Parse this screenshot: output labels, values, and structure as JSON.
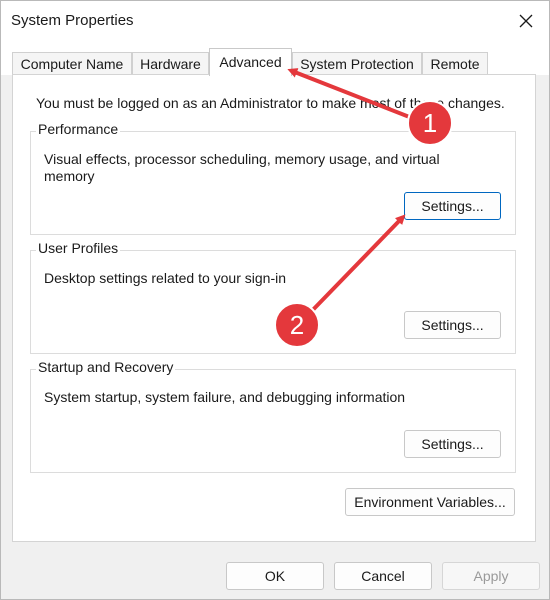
{
  "window": {
    "title": "System Properties"
  },
  "tabs": [
    {
      "label": "Computer Name"
    },
    {
      "label": "Hardware"
    },
    {
      "label": "Advanced"
    },
    {
      "label": "System Protection"
    },
    {
      "label": "Remote"
    }
  ],
  "active_tab": "Advanced",
  "notice": "You must be logged on as an Administrator to make most of these changes.",
  "groups": {
    "performance": {
      "label": "Performance",
      "description": "Visual effects, processor scheduling, memory usage, and virtual memory",
      "button": "Settings..."
    },
    "user_profiles": {
      "label": "User Profiles",
      "description": "Desktop settings related to your sign-in",
      "button": "Settings..."
    },
    "startup_recovery": {
      "label": "Startup and Recovery",
      "description": "System startup, system failure, and debugging information",
      "button": "Settings..."
    }
  },
  "env_button": "Environment Variables...",
  "footer": {
    "ok": "OK",
    "cancel": "Cancel",
    "apply": "Apply"
  },
  "annotations": [
    {
      "number": "1"
    },
    {
      "number": "2"
    }
  ],
  "colors": {
    "annotation": "#e4383c",
    "focus": "#0067c0"
  }
}
